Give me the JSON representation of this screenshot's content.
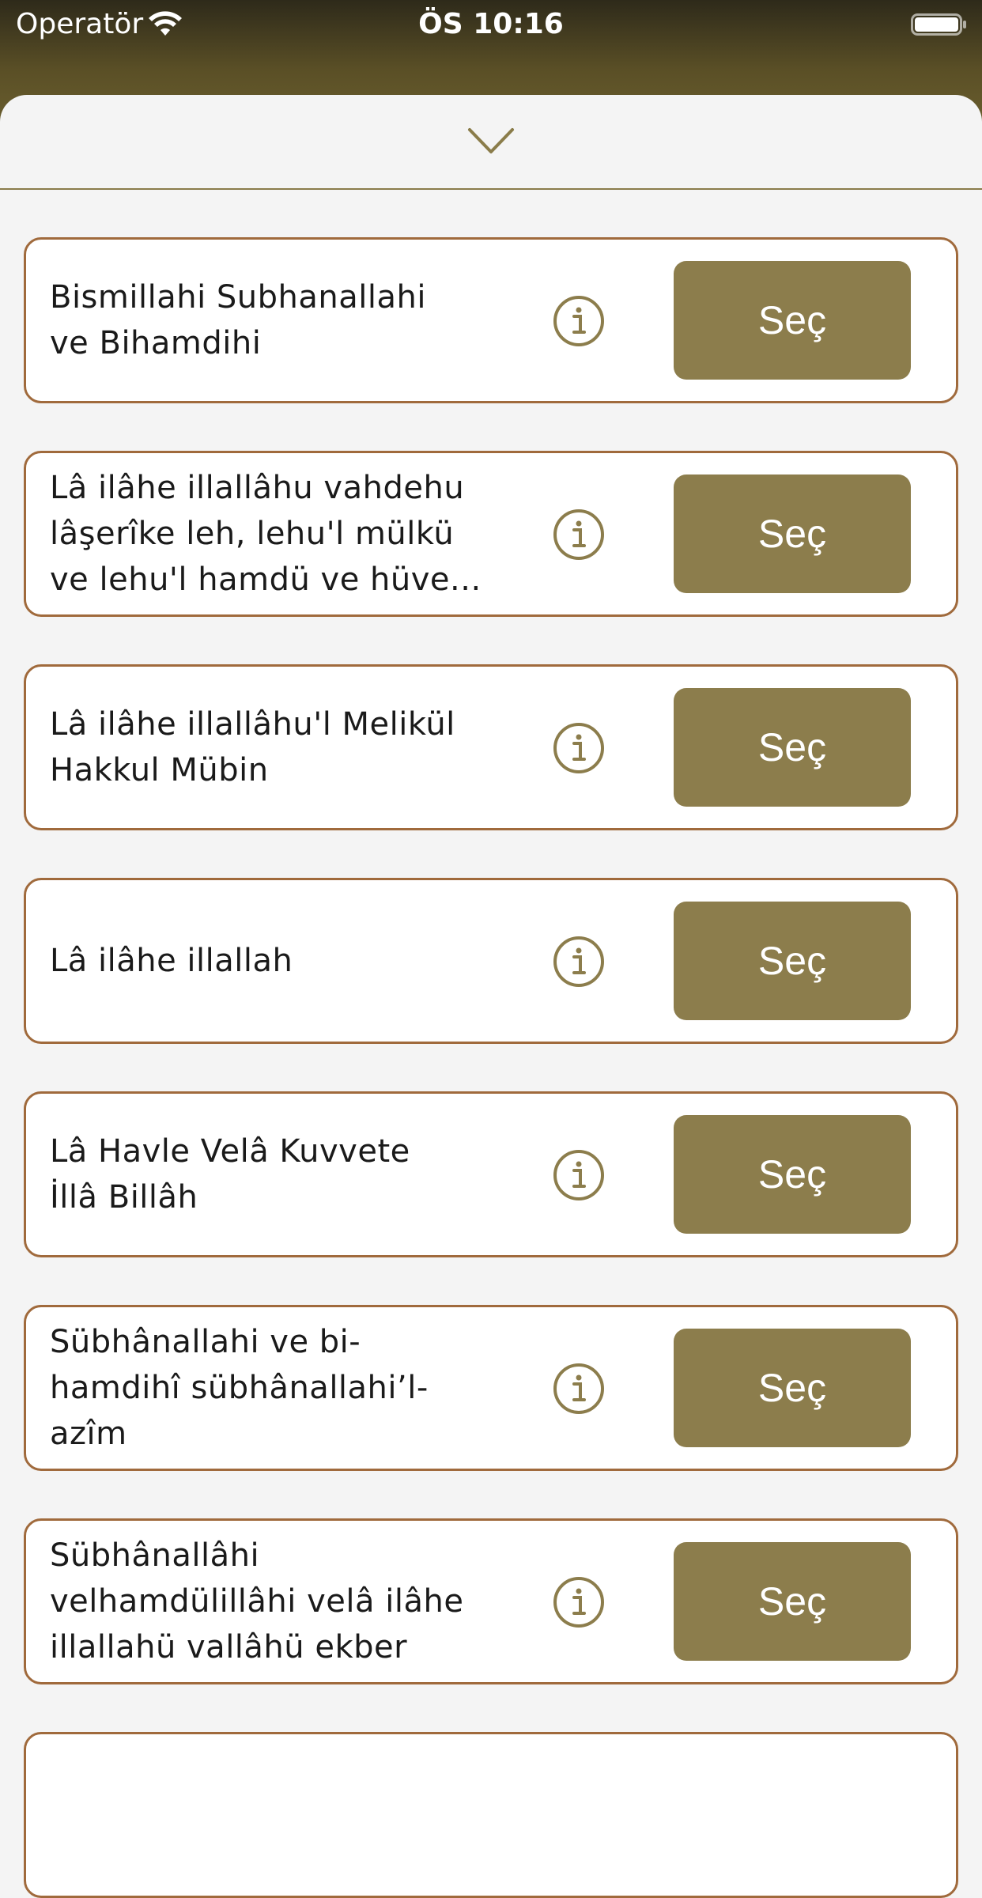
{
  "status_bar": {
    "carrier": "Operatör",
    "time": "ÖS 10:16"
  },
  "colors": {
    "accent": "#8c7d4c",
    "card_border": "#a06a3c",
    "header_dark": "#2e2a1a"
  },
  "items": [
    {
      "text": "Bismillahi Subhanallahi\nve Bihamdihi",
      "button": "Seç"
    },
    {
      "text": "Lâ ilâhe illallâhu vahdehu\nlâşerîke leh, lehu'l mülkü\nve lehu'l hamdü ve hüve...",
      "button": "Seç"
    },
    {
      "text": "Lâ ilâhe illallâhu'l Melikül\nHakkul Mübin",
      "button": "Seç"
    },
    {
      "text": "Lâ ilâhe illallah",
      "button": "Seç"
    },
    {
      "text": "Lâ Havle Velâ Kuvvete\nİllâ Billâh",
      "button": "Seç"
    },
    {
      "text": "Sübhânallahi ve bi-\nhamdihî sübhânallahi’l-\nazîm",
      "button": "Seç"
    },
    {
      "text": "Sübhânallâhi\nvelhamdülillâhi velâ ilâhe\nillallahü vallâhü ekber",
      "button": "Seç"
    }
  ]
}
